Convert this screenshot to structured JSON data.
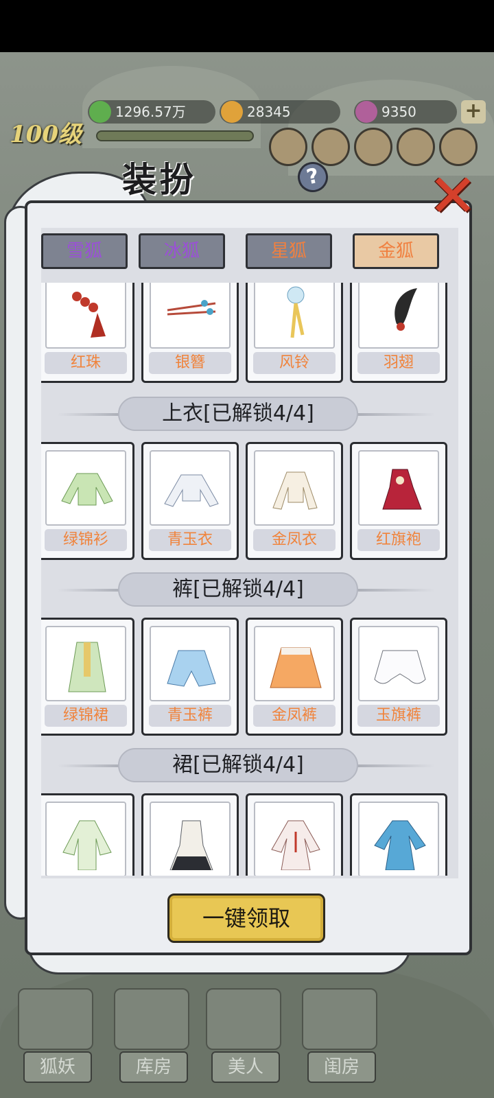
{
  "resources": [
    {
      "icon": "jade-icon",
      "value": "1296.57万",
      "color": "#5fae4e"
    },
    {
      "icon": "coin-icon",
      "value": "28345",
      "color": "#e0a23a"
    },
    {
      "icon": "gem-icon",
      "value": "9350",
      "color": "#b0609a"
    }
  ],
  "level": "100级",
  "dialog": {
    "title": "装扮",
    "tabs": [
      {
        "label": "雪狐",
        "color": "#9b4fd8"
      },
      {
        "label": "冰狐",
        "color": "#9b4fd8"
      },
      {
        "label": "星狐",
        "color": "#f08040"
      },
      {
        "label": "金狐",
        "color": "#f08040"
      }
    ],
    "sections": [
      {
        "header": "",
        "items": [
          "红珠",
          "银簪",
          "风铃",
          "羽翅"
        ]
      },
      {
        "header": "上衣[已解锁4/4]",
        "items": [
          "绿锦衫",
          "青玉衣",
          "金凤衣",
          "红旗袍"
        ]
      },
      {
        "header": "裤[已解锁4/4]",
        "items": [
          "绿锦裙",
          "青玉裤",
          "金凤裤",
          "玉旗裤"
        ]
      },
      {
        "header": "裙[已解锁4/4]",
        "items": [
          "",
          "",
          "",
          ""
        ]
      }
    ],
    "claim_label": "一键领取"
  },
  "nav": [
    "狐妖",
    "库房",
    "美人",
    "闺房"
  ]
}
